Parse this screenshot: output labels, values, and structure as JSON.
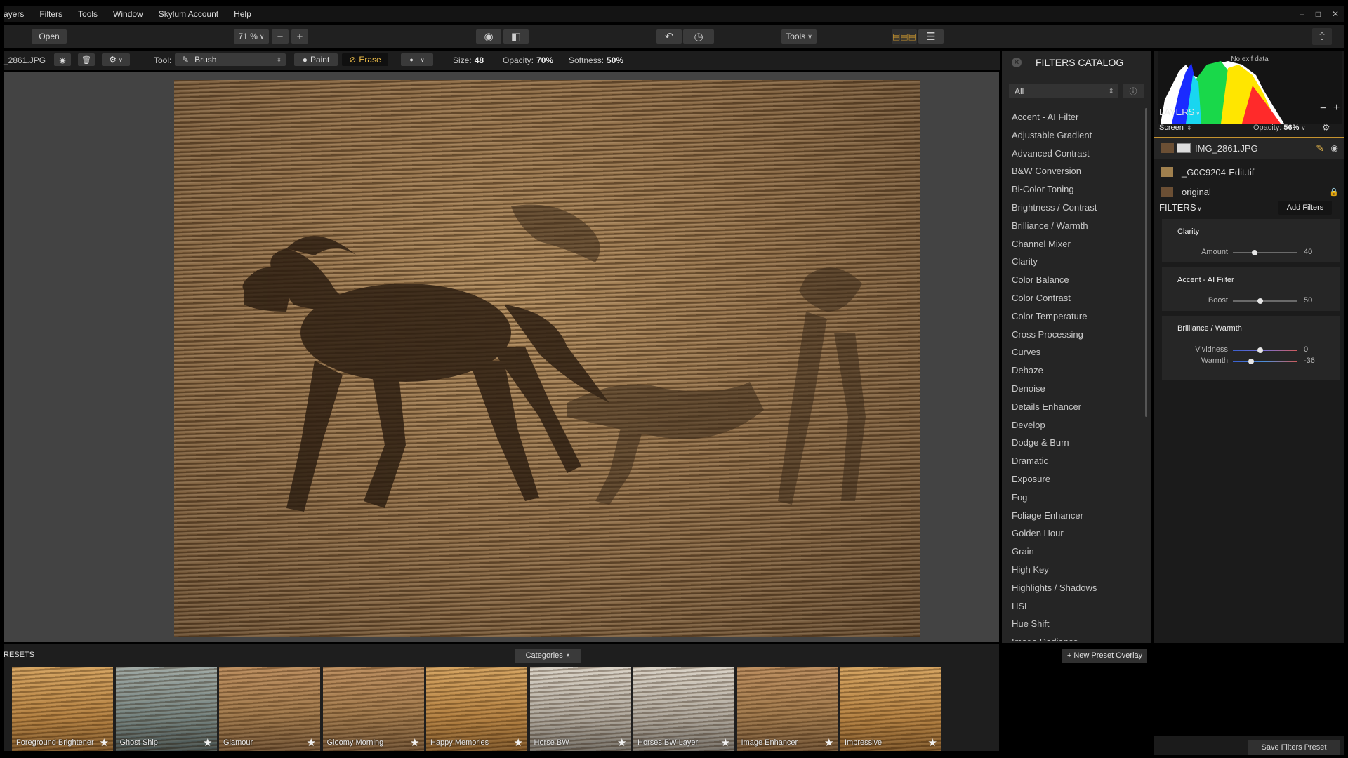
{
  "menu": [
    "ayers",
    "Filters",
    "Tools",
    "Window",
    "Skylum Account",
    "Help"
  ],
  "toolbar": {
    "open_label": "Open",
    "zoom": "71 %",
    "tools_label": "Tools"
  },
  "tool_options": {
    "filename": "_2861.JPG",
    "tool_label": "Tool:",
    "tool_value": "Brush",
    "paint_label": "Paint",
    "erase_label": "Erase",
    "size_label": "Size:",
    "size_value": "48",
    "opacity_label": "Opacity:",
    "opacity_value": "70%",
    "softness_label": "Softness:",
    "softness_value": "50%"
  },
  "catalog": {
    "title": "FILTERS CATALOG",
    "filter_value": "All",
    "items": [
      "Accent - AI Filter",
      "Adjustable Gradient",
      "Advanced Contrast",
      "B&W Conversion",
      "Bi-Color Toning",
      "Brightness / Contrast",
      "Brilliance / Warmth",
      "Channel Mixer",
      "Clarity",
      "Color Balance",
      "Color Contrast",
      "Color Temperature",
      "Cross Processing",
      "Curves",
      "Dehaze",
      "Denoise",
      "Details Enhancer",
      "Develop",
      "Dodge & Burn",
      "Dramatic",
      "Exposure",
      "Fog",
      "Foliage Enhancer",
      "Golden Hour",
      "Grain",
      "High Key",
      "Highlights / Shadows",
      "HSL",
      "Hue Shift",
      "Image Radiance"
    ]
  },
  "histogram": {
    "label": "No exif data"
  },
  "layers": {
    "title": "LAYERS",
    "blend_mode": "Screen",
    "opacity_label": "Opacity:",
    "opacity_value": "56%",
    "items": [
      {
        "name": "IMG_2861.JPG",
        "active": true
      },
      {
        "name": "_G0C9204-Edit.tif",
        "active": false
      },
      {
        "name": "original",
        "active": false
      }
    ]
  },
  "filters": {
    "title": "FILTERS",
    "add_label": "Add Filters",
    "cards": [
      {
        "title": "Clarity",
        "sliders": [
          {
            "label": "Amount",
            "value": "40",
            "pos": 0.34
          }
        ]
      },
      {
        "title": "Accent - AI Filter",
        "sliders": [
          {
            "label": "Boost",
            "value": "50",
            "pos": 0.42
          }
        ]
      },
      {
        "title": "Brilliance / Warmth",
        "sliders": [
          {
            "label": "Vividness",
            "value": "0",
            "pos": 0.42,
            "track": "#7a6fd0"
          },
          {
            "label": "Warmth",
            "value": "-36",
            "pos": 0.28,
            "track": "#4f8fd8"
          }
        ]
      }
    ]
  },
  "presets": {
    "title": "RESETS",
    "categories_label": "Categories",
    "new_overlay_label": "+ New Preset Overlay",
    "items": [
      {
        "name": "Foreground Brightener",
        "style": "warm"
      },
      {
        "name": "Ghost Ship",
        "style": "teal"
      },
      {
        "name": "Glamour",
        "style": ""
      },
      {
        "name": "Gloomy Morning",
        "style": ""
      },
      {
        "name": "Happy Memories",
        "style": "warm"
      },
      {
        "name": "Horse BW",
        "style": "bw"
      },
      {
        "name": "Horses BW Layer",
        "style": "bw"
      },
      {
        "name": "Image Enhancer",
        "style": ""
      },
      {
        "name": "Impressive",
        "style": "warm"
      }
    ],
    "star_glyph": "★"
  },
  "save_label": "Save Filters Preset",
  "colors": {
    "accent": "#c6932f",
    "erase_bg": "#101010"
  }
}
